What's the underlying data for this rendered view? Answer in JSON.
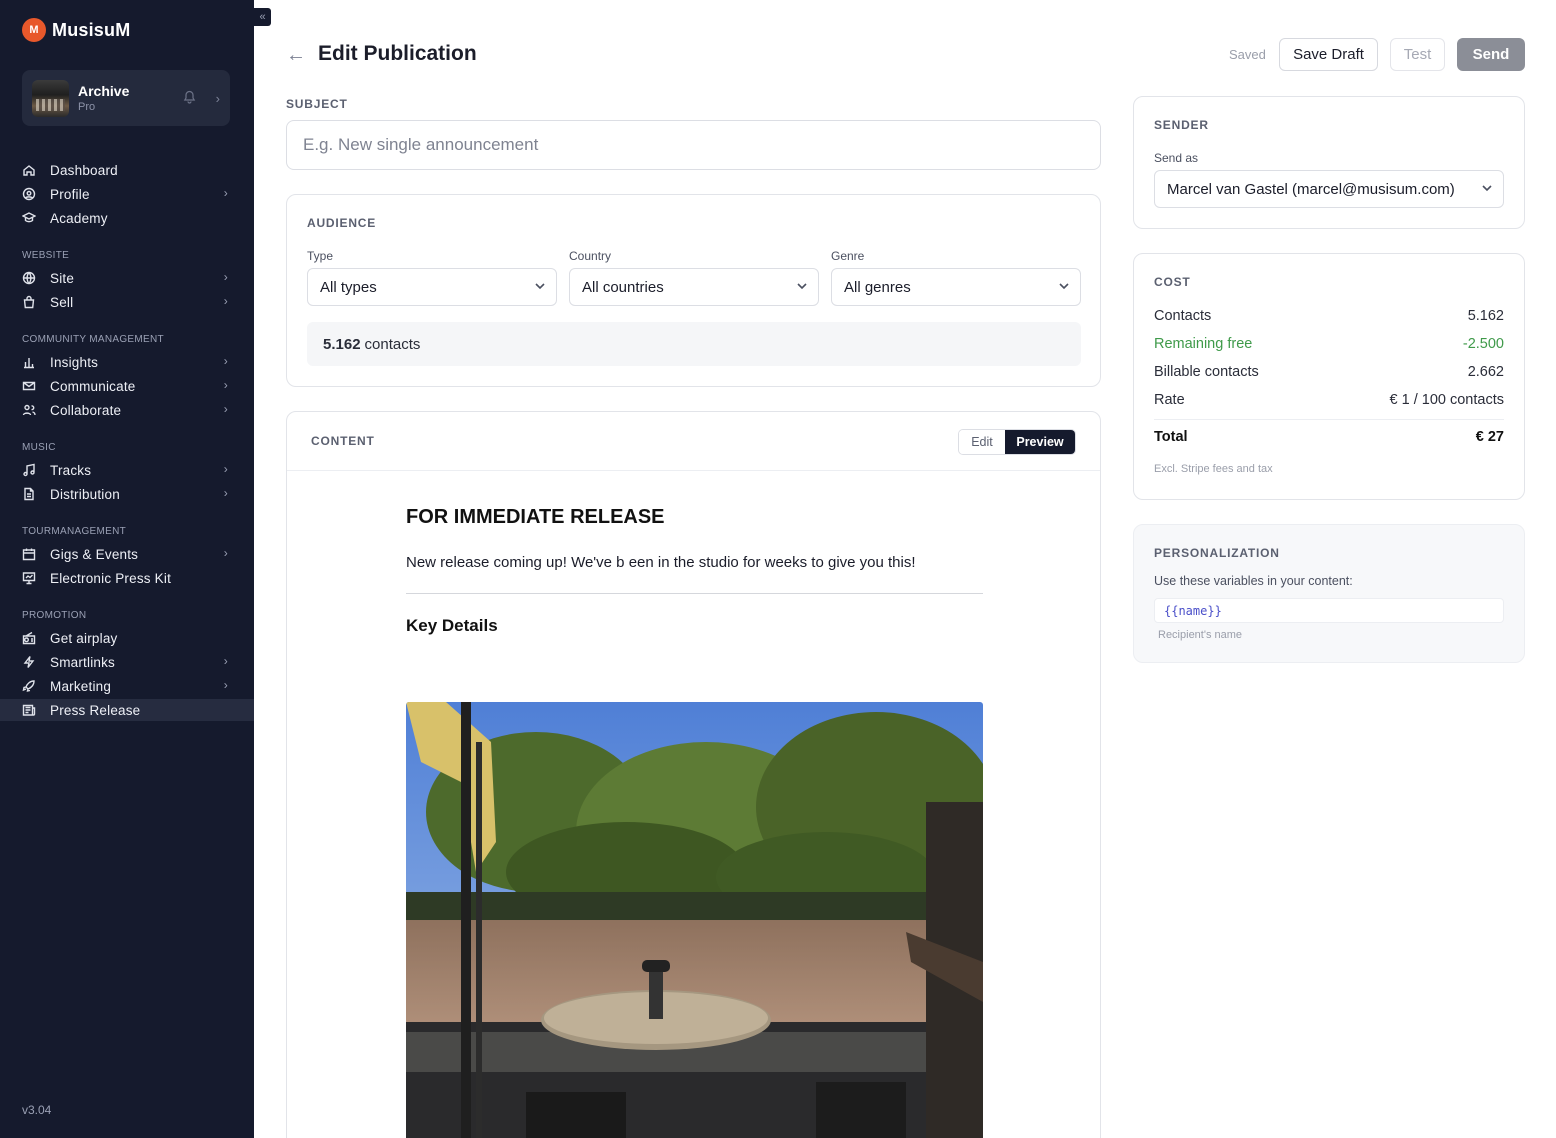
{
  "brand": {
    "name": "MusisuM",
    "logo_letter": "M"
  },
  "account": {
    "name": "Archive",
    "plan": "Pro"
  },
  "nav": {
    "top": [
      {
        "label": "Dashboard",
        "icon": "home-icon"
      },
      {
        "label": "Profile",
        "icon": "user-circle-icon",
        "chevron": true
      },
      {
        "label": "Academy",
        "icon": "graduation-cap-icon"
      }
    ],
    "sections": [
      {
        "title": "WEBSITE",
        "items": [
          {
            "label": "Site",
            "icon": "globe-icon",
            "chevron": true
          },
          {
            "label": "Sell",
            "icon": "shopping-bag-icon",
            "chevron": true
          }
        ]
      },
      {
        "title": "COMMUNITY MANAGEMENT",
        "items": [
          {
            "label": "Insights",
            "icon": "bar-chart-icon",
            "chevron": true
          },
          {
            "label": "Communicate",
            "icon": "mail-icon",
            "chevron": true
          },
          {
            "label": "Collaborate",
            "icon": "users-icon",
            "chevron": true
          }
        ]
      },
      {
        "title": "MUSIC",
        "items": [
          {
            "label": "Tracks",
            "icon": "music-note-icon",
            "chevron": true
          },
          {
            "label": "Distribution",
            "icon": "file-icon",
            "chevron": true
          }
        ]
      },
      {
        "title": "TOURMANAGEMENT",
        "items": [
          {
            "label": "Gigs & Events",
            "icon": "calendar-icon",
            "chevron": true
          },
          {
            "label": "Electronic Press Kit",
            "icon": "presentation-icon"
          }
        ]
      },
      {
        "title": "PROMOTION",
        "items": [
          {
            "label": "Get airplay",
            "icon": "radio-icon"
          },
          {
            "label": "Smartlinks",
            "icon": "lightning-icon",
            "chevron": true
          },
          {
            "label": "Marketing",
            "icon": "rocket-icon",
            "chevron": true
          },
          {
            "label": "Press Release",
            "icon": "newspaper-icon",
            "active": true
          }
        ]
      }
    ]
  },
  "version": "v3.04",
  "header": {
    "title": "Edit Publication",
    "saved": "Saved",
    "save_draft": "Save Draft",
    "test": "Test",
    "send": "Send"
  },
  "subject": {
    "label": "SUBJECT",
    "placeholder": "E.g. New single announcement"
  },
  "audience": {
    "label": "AUDIENCE",
    "type_label": "Type",
    "type_value": "All types",
    "country_label": "Country",
    "country_value": "All countries",
    "genre_label": "Genre",
    "genre_value": "All genres",
    "contacts_count": "5.162",
    "contacts_suffix": "contacts"
  },
  "content": {
    "label": "CONTENT",
    "edit": "Edit",
    "preview": "Preview",
    "heading": "FOR IMMEDIATE RELEASE",
    "body": "New release coming up! We've b een in the studio for weeks to give you this!",
    "subheading": "Key Details"
  },
  "sender": {
    "label": "SENDER",
    "send_as_label": "Send as",
    "send_as_value": "Marcel van Gastel (marcel@musisum.com)"
  },
  "cost": {
    "label": "COST",
    "rows": [
      {
        "label": "Contacts",
        "value": "5.162"
      },
      {
        "label": "Remaining free",
        "value": "-2.500"
      },
      {
        "label": "Billable contacts",
        "value": "2.662"
      },
      {
        "label": "Rate",
        "value": "€ 1 / 100 contacts"
      }
    ],
    "total_label": "Total",
    "total_value": "€ 27",
    "note": "Excl. Stripe fees and tax"
  },
  "personalization": {
    "label": "PERSONALIZATION",
    "text": "Use these variables in your content:",
    "variable": "{{name}}",
    "variable_desc": "Recipient's name"
  },
  "colors": {
    "sidebar_bg": "#151a2d",
    "accent": "#e8582b",
    "green": "#3f9a4a",
    "send_disabled": "#8b8e97"
  }
}
